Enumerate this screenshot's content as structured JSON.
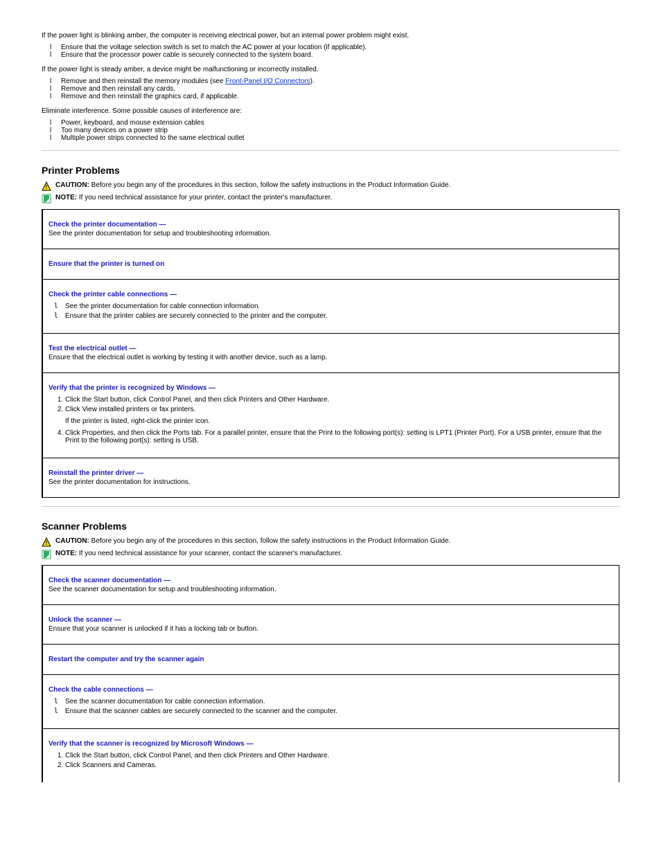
{
  "intro": {
    "line1": "If the power light is blinking amber, the computer is receiving electrical power, but an internal power problem might exist.",
    "bullets": [
      "Ensure that the voltage selection switch is set to match the AC power at your location (if applicable).",
      "Ensure that the processor power cable is securely connected to the system board."
    ],
    "line2_pre": "If the power light is steady amber, a device might be malfunctioning or incorrectly installed.",
    "bullets2": [
      {
        "pre": "Remove and then reinstall the memory modules (see ",
        "link": "Front-Panel I/O Connectors",
        "post": ")."
      },
      {
        "pre": "Remove and then reinstall any cards.",
        "link": "",
        "post": ""
      },
      {
        "pre": "Remove and then reinstall the graphics card, if applicable.",
        "link": "",
        "post": ""
      }
    ],
    "line3": "Eliminate interference. Some possible causes of interference are:",
    "bullets3": [
      "Power, keyboard, and mouse extension cables",
      "Too many devices on a power strip",
      "Multiple power strips connected to the same electrical outlet"
    ]
  },
  "printer": {
    "title": "Printer Problems",
    "caution_label": "CAUTION:",
    "caution_text": "Before you begin any of the procedures in this section, follow the safety instructions in the Product Information Guide.",
    "note_label": "NOTE:",
    "note_text": "If you need technical assistance for your printer, contact the printer's manufacturer.",
    "rows": [
      {
        "hd": "Check the printer documentation  —",
        "body_items": [
          "See the printer documentation for setup and troubleshooting information."
        ]
      },
      {
        "hd": "Ensure that the printer is turned on"
      },
      {
        "hd": "Check the printer cable connections  —",
        "ul": [
          "See the printer documentation for cable connection information.",
          "Ensure that the printer cables are securely connected to the printer and the computer."
        ]
      },
      {
        "hd": "Test the electrical outlet  —",
        "after": "Ensure that the electrical outlet is working by testing it with another device, such as a lamp."
      },
      {
        "hd": "Verify that the printer is recognized by Windows  —",
        "ol": [
          "Click the Start button, click Control Panel, and then click Printers and Other Hardware.",
          "Click View installed printers or fax printers.",
          "If the printer is listed, right-click the printer icon.",
          "Click Properties, and then click the Ports tab. For a parallel printer, ensure that the Print to the following port(s): setting is LPT1 (Printer Port). For a USB printer, ensure that the Print to the following port(s): setting is USB."
        ]
      },
      {
        "hd": "Reinstall the printer driver  —",
        "after": "See the printer documentation for instructions."
      }
    ]
  },
  "scanner": {
    "title": "Scanner Problems",
    "caution_label": "CAUTION:",
    "caution_text": "Before you begin any of the procedures in this section, follow the safety instructions in the Product Information Guide.",
    "note_label": "NOTE:",
    "note_text": "If you need technical assistance for your scanner, contact the scanner's manufacturer.",
    "rows": [
      {
        "hd": "Check the scanner documentation  —",
        "after": "See the scanner documentation for setup and troubleshooting information."
      },
      {
        "hd": "Unlock the scanner  —",
        "after": "Ensure that your scanner is unlocked if it has a locking tab or button."
      },
      {
        "hd_only": "Restart the computer and try the scanner again"
      },
      {
        "hd": "Check the cable connections  —",
        "ul": [
          "See the scanner documentation for cable connection information.",
          "Ensure that the scanner cables are securely connected to the scanner and the computer."
        ]
      },
      {
        "hd": "Verify that the scanner is recognized by Microsoft Windows  —",
        "ol": [
          "Click the Start button, click Control Panel, and then click Printers and Other Hardware.",
          "Click Scanners and Cameras."
        ]
      }
    ]
  }
}
